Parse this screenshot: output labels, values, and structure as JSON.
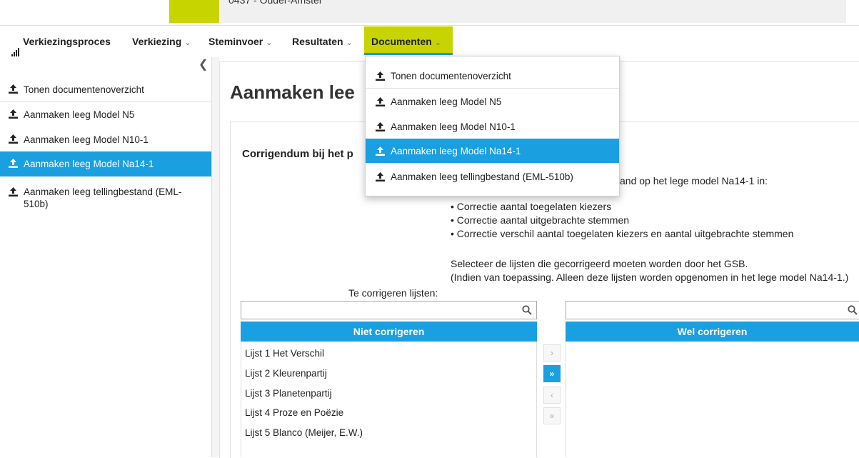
{
  "header": {
    "municipality": "0437 - Ouder-Amstel"
  },
  "nav": {
    "items": [
      {
        "label": "Verkiezingsproces"
      },
      {
        "label": "Verkiezing"
      },
      {
        "label": "Steminvoer"
      },
      {
        "label": "Resultaten"
      },
      {
        "label": "Documenten"
      }
    ],
    "active": "Documenten"
  },
  "sidebar": {
    "collapse_icon": "chevron-left-icon",
    "items": [
      {
        "label": "Tonen documentenoverzicht"
      },
      {
        "label": "Aanmaken leeg Model N5"
      },
      {
        "label": "Aanmaken leeg Model N10-1"
      },
      {
        "label": "Aanmaken leeg Model Na14-1"
      },
      {
        "label": "Aanmaken leeg tellingbestand (EML-510b)"
      }
    ],
    "active_index": 3
  },
  "dropdown": {
    "items": [
      {
        "label": "Tonen documentenoverzicht"
      },
      {
        "label": "Aanmaken leeg Model N5"
      },
      {
        "label": "Aanmaken leeg Model N10-1"
      },
      {
        "label": "Aanmaken leeg Model Na14-1"
      },
      {
        "label": "Aanmaken leeg tellingbestand (EML-510b)"
      }
    ],
    "active_index": 3
  },
  "main": {
    "title": "Aanmaken lee",
    "section_title": "Corrigendum bij het p",
    "intro_tail": "and  op het lege model Na14-1 in:",
    "bullets": [
      "• Correctie aantal toegelaten kiezers",
      "• Correctie aantal uitgebrachte stemmen",
      "• Correctie verschil aantal toegelaten kiezers en aantal uitgebrachte stemmen"
    ],
    "select_text_1": "Selecteer de lijsten die gecorrigeerd moeten worden door het GSB.",
    "select_text_2": "(Indien van toepassing. Alleen deze lijsten worden opgenomen in het lege model Na14-1.)",
    "lists_label": "Te corrigeren lijsten:"
  },
  "left_list": {
    "search_placeholder": "",
    "header": "Niet corrigeren",
    "items": [
      "Lijst 1 Het Verschil",
      "Lijst 2 Kleurenpartij",
      "Lijst 3 Planetenpartij",
      "Lijst 4 Proze en Poëzie",
      "Lijst 5 Blanco (Meijer, E.W.)"
    ]
  },
  "right_list": {
    "search_placeholder": "",
    "header": "Wel corrigeren",
    "items": []
  },
  "move_buttons": [
    {
      "glyph": "›",
      "icon": "move-selected-right-icon",
      "enabled": false
    },
    {
      "glyph": "»",
      "icon": "move-all-right-icon",
      "enabled": true
    },
    {
      "glyph": "‹",
      "icon": "move-selected-left-icon",
      "enabled": false
    },
    {
      "glyph": "«",
      "icon": "move-all-left-icon",
      "enabled": false
    }
  ],
  "colors": {
    "accent": "#1a9fe0",
    "brand_lime": "#c8d400"
  }
}
